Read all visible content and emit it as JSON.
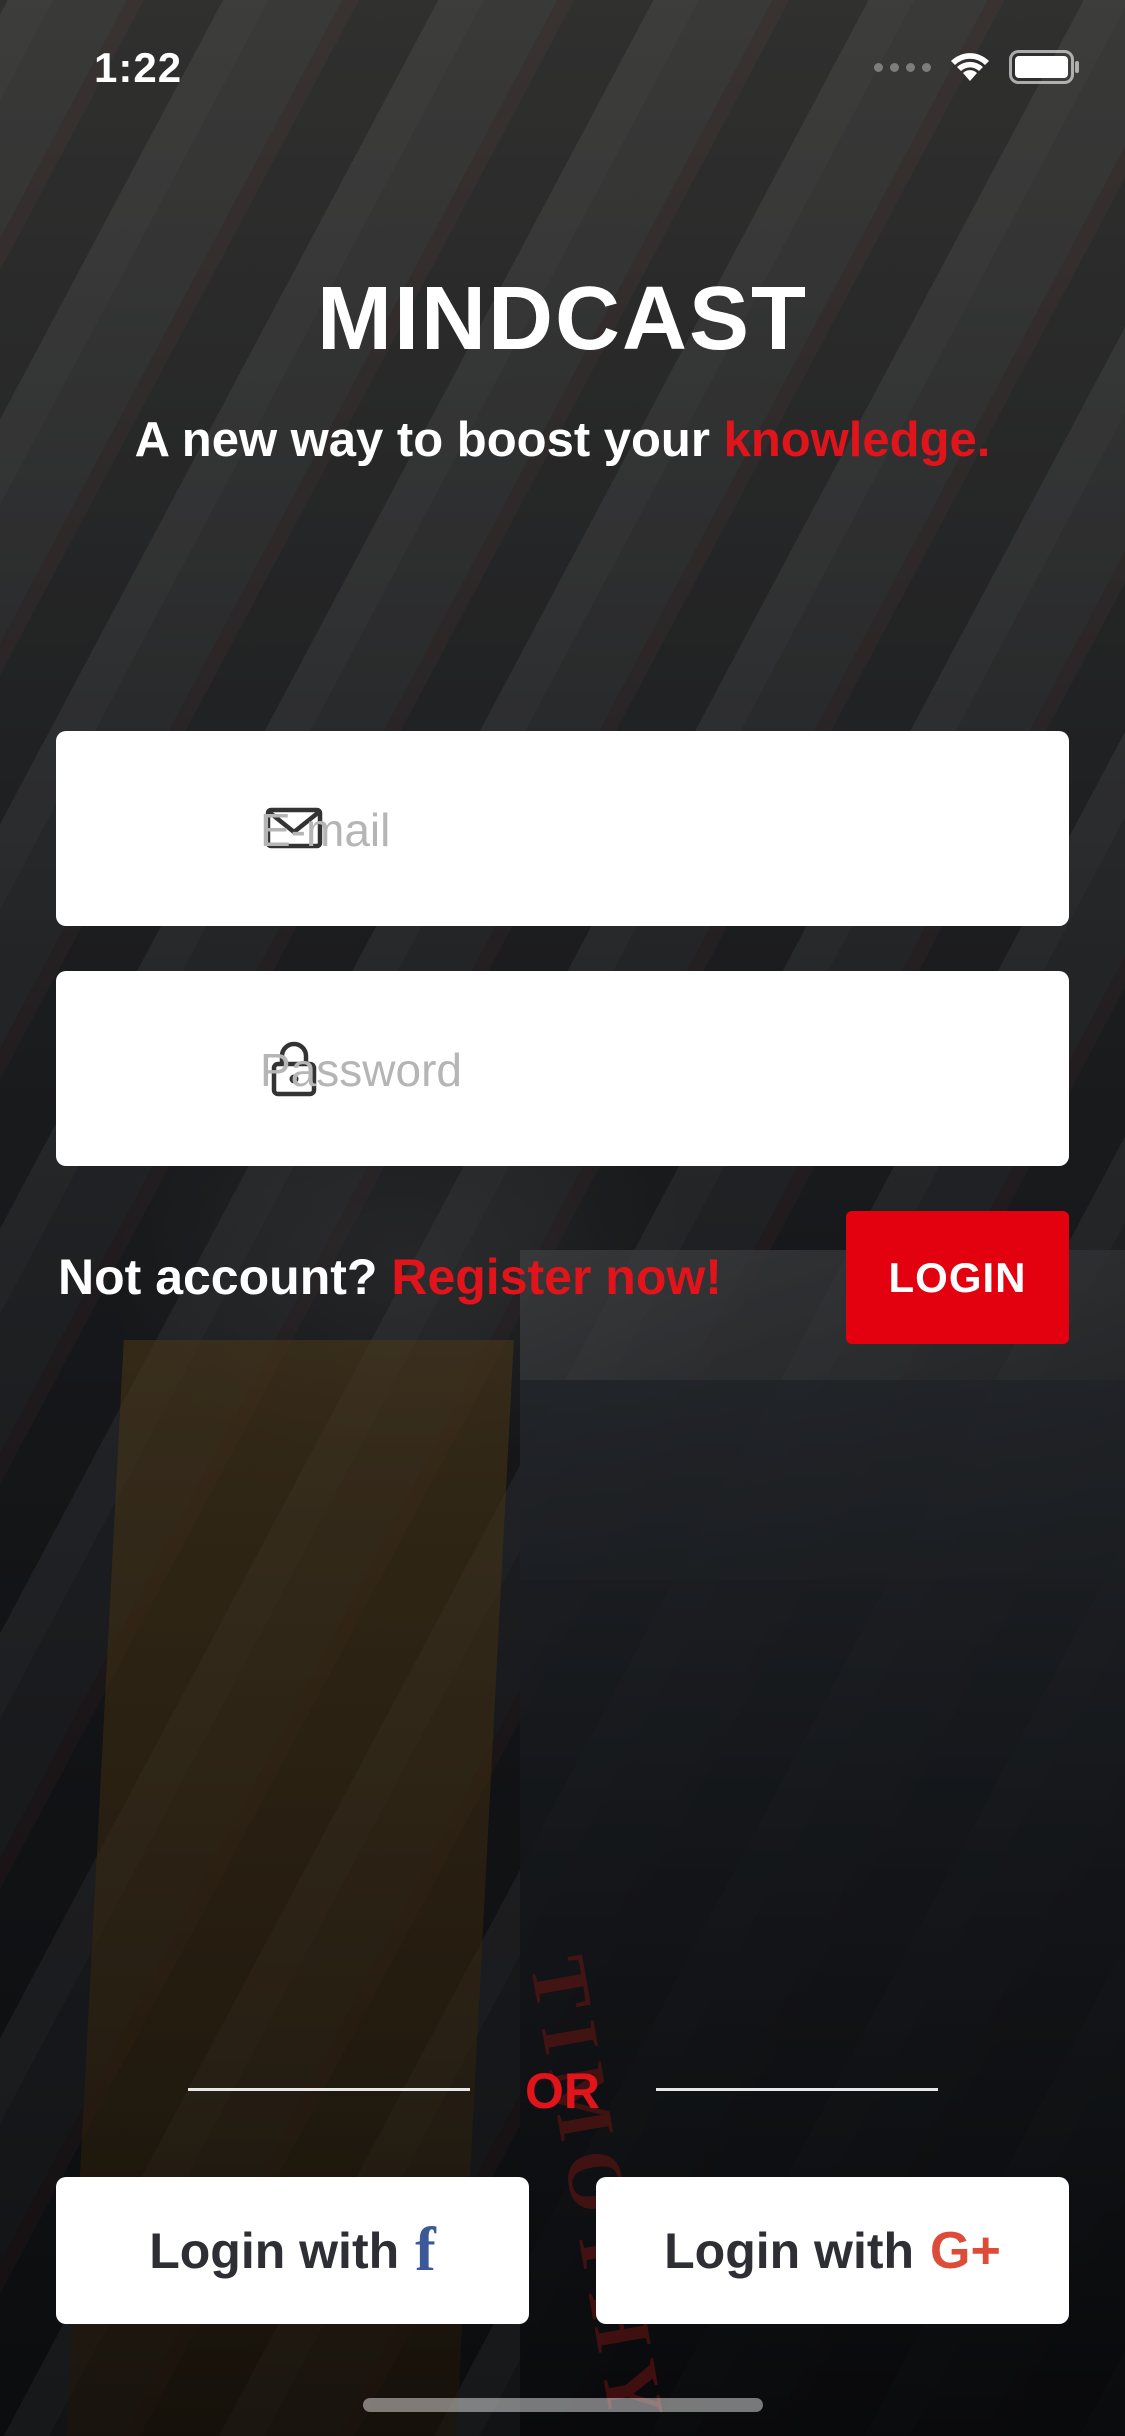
{
  "status_bar": {
    "time": "1:22"
  },
  "header": {
    "brand": "MINDCAST",
    "tagline_prefix": "A new way to boost your",
    "tagline_accent": "knowledge."
  },
  "form": {
    "email_placeholder": "E-mail",
    "email_value": "",
    "password_placeholder": "Password",
    "password_value": "",
    "register_prompt": "Not account?",
    "register_link": "Register now!",
    "login_label": "LOGIN"
  },
  "divider": {
    "label": "OR"
  },
  "social": {
    "facebook_label": "Login with",
    "facebook_glyph": "f",
    "google_label": "Login with",
    "google_glyph": "G+"
  },
  "background": {
    "book_spine_text": "TIMOTHY"
  },
  "colors": {
    "accent": "#e3000f",
    "facebook": "#3b5998",
    "google": "#dd4b39"
  },
  "icons": [
    "mail-icon",
    "lock-icon",
    "wifi-icon",
    "battery-icon",
    "facebook-icon",
    "google-plus-icon"
  ]
}
